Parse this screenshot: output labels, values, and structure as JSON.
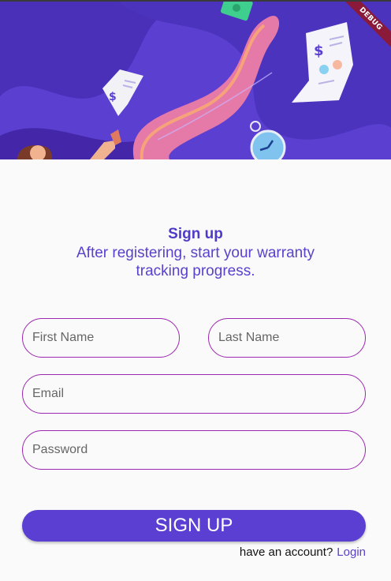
{
  "debug_banner": "DEBUG",
  "heading": {
    "title": "Sign up",
    "subtitle": "After registering, start your warranty tracking progress."
  },
  "form": {
    "first_name_placeholder": "First Name",
    "last_name_placeholder": "Last Name",
    "email_placeholder": "Email",
    "password_placeholder": "Password",
    "submit_label": "SIGN UP"
  },
  "footer": {
    "question": "have an account?",
    "login_link": "Login"
  },
  "colors": {
    "primary": "#5a3fd2",
    "field_border": "#9c27b0",
    "background": "#fafafa"
  }
}
